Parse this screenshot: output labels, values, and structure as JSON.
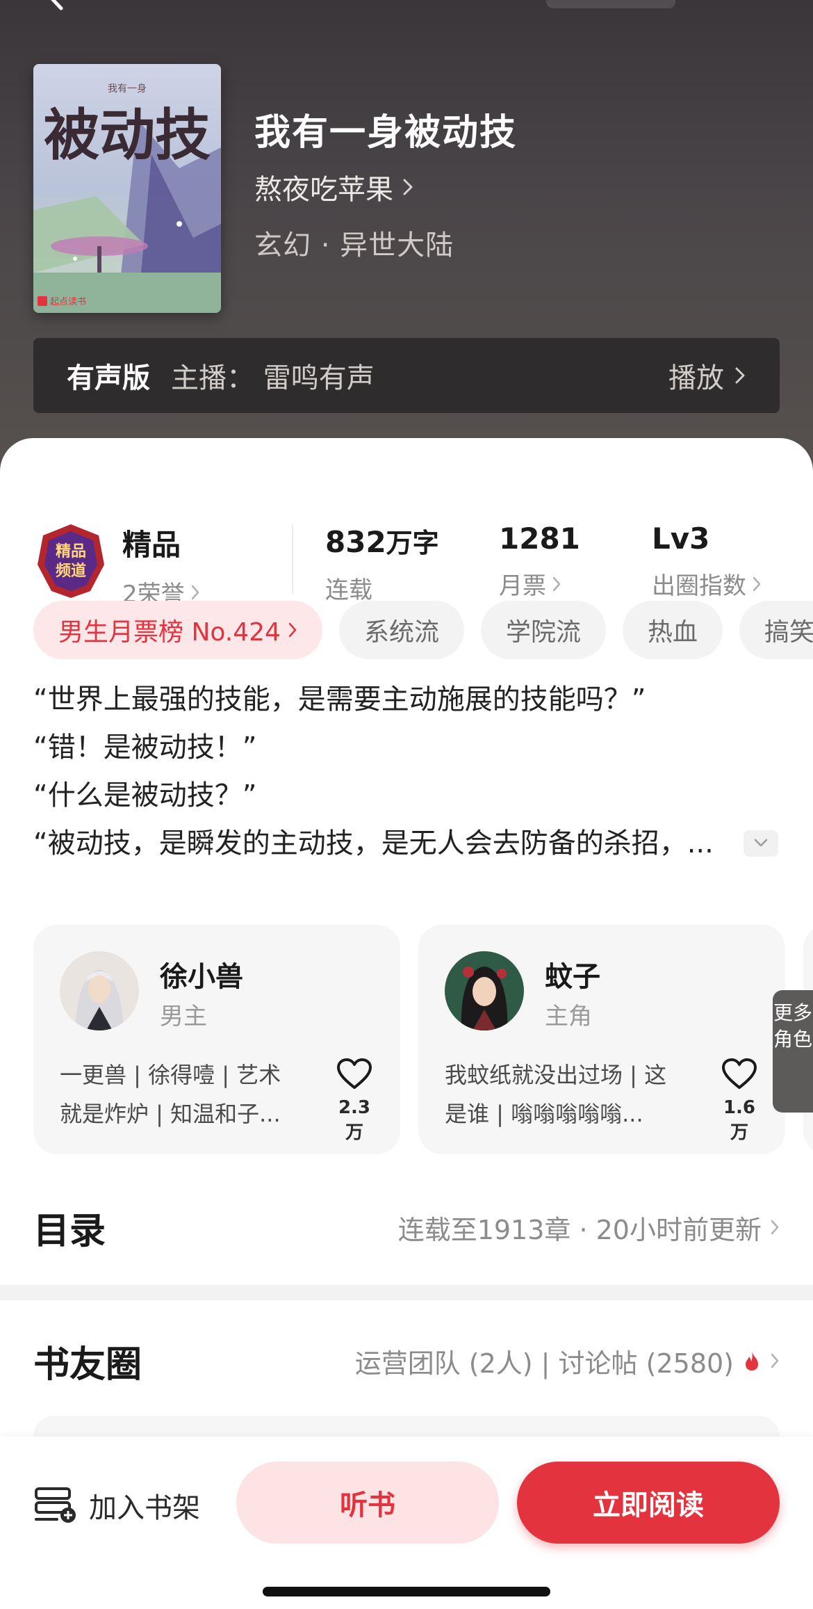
{
  "header": {
    "book_title": "我有一身被动技",
    "author": "熬夜吃苹果",
    "category": "玄幻 · 异世大陆",
    "cover_title": "被动技",
    "cover_subtitle": "我有一身",
    "cover_publisher": "起点读书"
  },
  "audio": {
    "tag": "有声版",
    "host": "主播：  雷鸣有声",
    "play_label": "播放"
  },
  "stats": {
    "honor_badge": "精品",
    "honor_sub": "2荣誉",
    "words_value": "832",
    "words_unit": "万字",
    "words_sub": "连载",
    "tickets_value": "1281",
    "tickets_sub": "月票",
    "level_value": "Lv3",
    "level_sub": "出圈指数"
  },
  "tags": {
    "rank": "男生月票榜 No.424",
    "items": [
      "系统流",
      "学院流",
      "热血",
      "搞笑"
    ]
  },
  "synopsis": {
    "lines": [
      "“世界上最强的技能，是需要主动施展的技能吗？”",
      "“错！是被动技！”",
      "“什么是被动技？”",
      "“被动技，是瞬发的主动技，是无人会去防备的杀招，..."
    ]
  },
  "characters": [
    {
      "name": "徐小兽",
      "role": "男主",
      "desc_line1": "一更兽 | 徐得噎 | 艺术",
      "desc_line2": "就是炸炉 | 知温和子...",
      "likes": "2.3万"
    },
    {
      "name": "蚊子",
      "role": "主角",
      "desc_line1": "我蚊纸就没出过场 | 这",
      "desc_line2": "是谁 | 嗡嗡嗡嗡嗡...",
      "likes": "1.6万"
    }
  ],
  "more_roles": "更多角色",
  "toc": {
    "title": "目录",
    "status": "连载至1913章 · 20小时前更新"
  },
  "circle": {
    "title": "书友圈",
    "meta": "运营团队 (2人) | 讨论帖 (2580)"
  },
  "bottom": {
    "shelf_label": "加入书架",
    "listen_label": "听书",
    "read_label": "立即阅读"
  },
  "colors": {
    "accent": "#e2333e",
    "accent_light": "#fde3e4",
    "header_bg": "#4a4548"
  }
}
